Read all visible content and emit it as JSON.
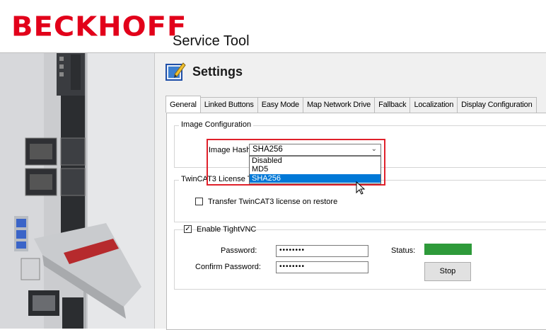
{
  "header": {
    "logo": "BECKHOFF",
    "app_title": "Service Tool"
  },
  "page": {
    "title": "Settings"
  },
  "tabs": [
    {
      "label": "General",
      "active": true
    },
    {
      "label": "Linked Buttons"
    },
    {
      "label": "Easy Mode"
    },
    {
      "label": "Map Network Drive"
    },
    {
      "label": "Fallback"
    },
    {
      "label": "Localization"
    },
    {
      "label": "Display Configuration"
    }
  ],
  "image_config": {
    "group_label": "Image Configuration",
    "hash_label": "Image Hash",
    "hash_value": "SHA256",
    "options": [
      "Disabled",
      "MD5",
      "SHA256"
    ],
    "selected_option": "SHA256"
  },
  "twincat": {
    "group_label": "TwinCAT3 License Tra",
    "transfer_label": "Transfer TwinCAT3 license on restore",
    "transfer_checked": false
  },
  "vnc": {
    "enable_label": "Enable TightVNC",
    "enabled": true,
    "password_label": "Password:",
    "password_value": "••••••••",
    "confirm_label": "Confirm Password:",
    "confirm_value": "••••••••",
    "status_label": "Status:",
    "status_color": "#2e9a3a",
    "stop_label": "Stop"
  },
  "colors": {
    "brand": "#e2001a",
    "highlight": "#e0212b",
    "selection": "#0078d7"
  }
}
